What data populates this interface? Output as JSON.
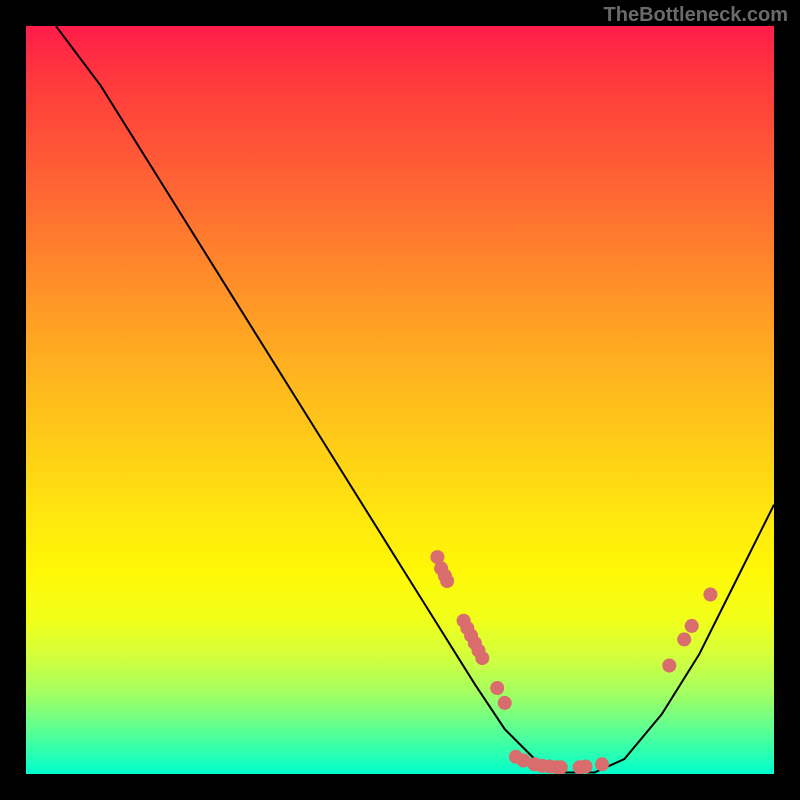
{
  "watermark": "TheBottleneck.com",
  "chart_data": {
    "type": "line",
    "title": "",
    "xlabel": "",
    "ylabel": "",
    "xlim": [
      0,
      100
    ],
    "ylim": [
      0,
      100
    ],
    "series": [
      {
        "name": "curve",
        "x": [
          4,
          10,
          20,
          30,
          40,
          50,
          55,
          60,
          64,
          68,
          72,
          76,
          80,
          85,
          90,
          95,
          100
        ],
        "y": [
          100,
          92,
          76,
          60,
          44,
          28,
          20,
          12,
          6,
          2,
          0.2,
          0.2,
          2,
          8,
          16,
          26,
          36
        ]
      }
    ],
    "points": [
      {
        "x": 55.0,
        "y": 29.0
      },
      {
        "x": 55.5,
        "y": 27.5
      },
      {
        "x": 56.0,
        "y": 26.5
      },
      {
        "x": 56.3,
        "y": 25.8
      },
      {
        "x": 58.5,
        "y": 20.5
      },
      {
        "x": 59.0,
        "y": 19.5
      },
      {
        "x": 59.5,
        "y": 18.5
      },
      {
        "x": 60.0,
        "y": 17.5
      },
      {
        "x": 60.5,
        "y": 16.5
      },
      {
        "x": 61.0,
        "y": 15.5
      },
      {
        "x": 63.0,
        "y": 11.5
      },
      {
        "x": 64.0,
        "y": 9.5
      },
      {
        "x": 65.5,
        "y": 2.3
      },
      {
        "x": 66.5,
        "y": 1.8
      },
      {
        "x": 68.0,
        "y": 1.3
      },
      {
        "x": 69.0,
        "y": 1.1
      },
      {
        "x": 70.0,
        "y": 1.0
      },
      {
        "x": 71.0,
        "y": 0.9
      },
      {
        "x": 71.5,
        "y": 0.9
      },
      {
        "x": 74.0,
        "y": 0.9
      },
      {
        "x": 74.8,
        "y": 1.0
      },
      {
        "x": 77.0,
        "y": 1.3
      },
      {
        "x": 86.0,
        "y": 14.5
      },
      {
        "x": 88.0,
        "y": 18.0
      },
      {
        "x": 89.0,
        "y": 19.8
      },
      {
        "x": 91.5,
        "y": 24.0
      }
    ],
    "point_color": "#d96c6c",
    "point_radius_px": 7
  }
}
